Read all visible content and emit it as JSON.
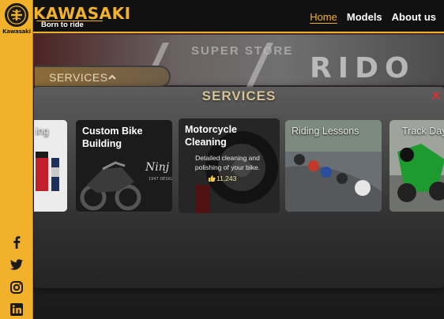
{
  "brand": {
    "name": "KAWASAKI",
    "tagline": "Born to ride",
    "sidebar_label": "Kawasaki"
  },
  "nav": {
    "items": [
      {
        "label": "Home",
        "active": true
      },
      {
        "label": "Models",
        "active": false
      },
      {
        "label": "About us",
        "active": false
      }
    ]
  },
  "hero": {
    "store_text": "SUPER STORE",
    "ride_text": "RIDO"
  },
  "services_pill": {
    "label": "SERVICES",
    "icon": "chevron-up-icon"
  },
  "modal": {
    "title": "SERVICES",
    "close_icon": "close-icon",
    "cards": [
      {
        "title": "ing",
        "partial": true
      },
      {
        "title": "Custom Bike Building"
      },
      {
        "title": "Motorcycle Cleaning",
        "description": "Detailed cleaning and polishing of your bike.",
        "likes": "11,243",
        "hovered": true
      },
      {
        "title": "Riding Lessons"
      },
      {
        "title": "Track Day",
        "partial": true
      }
    ]
  },
  "social": [
    {
      "icon": "facebook-icon"
    },
    {
      "icon": "twitter-icon"
    },
    {
      "icon": "instagram-icon"
    },
    {
      "icon": "linkedin-icon"
    }
  ],
  "colors": {
    "accent": "#f2b12a",
    "topbar": "#111111",
    "close": "#d93030"
  }
}
